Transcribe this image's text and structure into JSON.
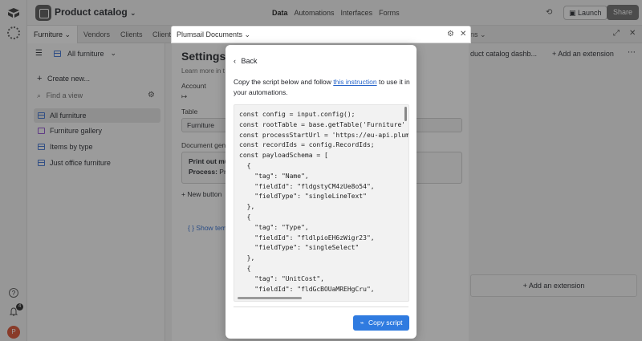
{
  "header": {
    "base_name": "Product catalog",
    "nav": [
      "Data",
      "Automations",
      "Interfaces",
      "Forms"
    ],
    "nav_active": "Data",
    "launch_label": "Launch",
    "share_label": "Share"
  },
  "tabs": {
    "active": "Furniture",
    "items": [
      "Vendors",
      "Clients",
      "Client"
    ],
    "right_partial": "ns"
  },
  "sidebar": {
    "view_name": "All furniture",
    "create_label": "Create new...",
    "find_placeholder": "Find a view",
    "views": [
      {
        "label": "All furniture",
        "icon": "grid-icon",
        "selected": true
      },
      {
        "label": "Furniture gallery",
        "icon": "gallery-icon",
        "selected": false
      },
      {
        "label": "Items by type",
        "icon": "grid-icon",
        "selected": false
      },
      {
        "label": "Just office furniture",
        "icon": "grid-icon",
        "selected": false
      }
    ]
  },
  "settings": {
    "title": "Settings",
    "learn_more": "Learn more in t",
    "account_label": "Account",
    "table_label": "Table",
    "table_value": "Furniture",
    "docgen_label": "Document gen",
    "doc_title": "Print out mu",
    "doc_process_label": "Process:",
    "doc_process_value": "Pri",
    "new_button": "New button",
    "show_templates": "Show temp"
  },
  "extensions": {
    "dashboard_title": "duct catalog dashb...",
    "add_extension": "Add an extension",
    "add_extension_big": "Add an extension"
  },
  "plumsail": {
    "window_title": "Plumsail Documents"
  },
  "modal": {
    "back_label": "Back",
    "intro_before": "Copy the script below and follow ",
    "intro_link": "this instruction",
    "intro_after": " to use it in your automations.",
    "code": "const config = input.config();\nconst rootTable = base.getTable('Furniture'\nconst processStartUrl = 'https://eu-api.plum\nconst recordIds = config.RecordIds;\nconst payloadSchema = [\n  {\n    \"tag\": \"Name\",\n    \"fieldId\": \"fldgstyCM4zUe8o54\",\n    \"fieldType\": \"singleLineText\"\n  },\n  {\n    \"tag\": \"Type\",\n    \"fieldId\": \"fldlpioEH6zWigr23\",\n    \"fieldType\": \"singleSelect\"\n  },\n  {\n    \"tag\": \"UnitCost\",\n    \"fieldId\": \"fldGcBOUaMREHgCru\",",
    "copy_label": "Copy script"
  },
  "user": {
    "avatar_initial": "P",
    "notification_count": "4"
  },
  "colors": {
    "primary_button": "#2f7be0",
    "link": "#2563c9",
    "avatar": "#d94c2b"
  }
}
